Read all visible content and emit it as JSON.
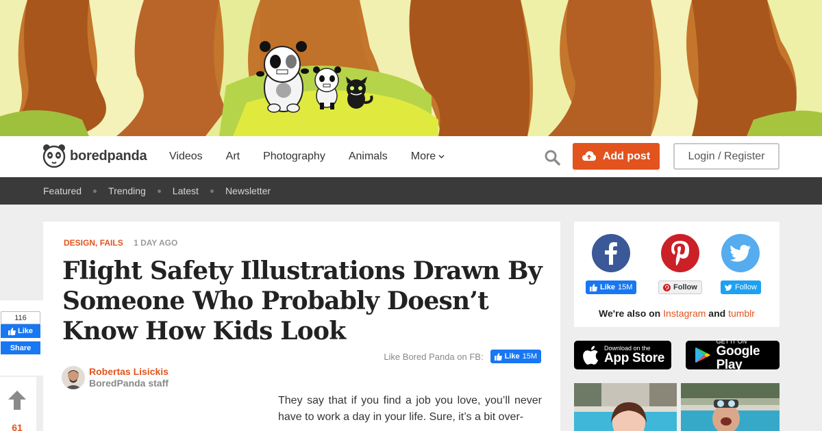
{
  "brand": {
    "name": "boredpanda"
  },
  "nav": {
    "items": [
      "Videos",
      "Art",
      "Photography",
      "Animals"
    ],
    "more_label": "More",
    "add_post_label": "Add post",
    "login_label": "Login / Register"
  },
  "subnav": {
    "items": [
      "Featured",
      "Trending",
      "Latest",
      "Newsletter"
    ]
  },
  "article": {
    "categories": [
      "DESIGN",
      "FAILS"
    ],
    "category_separator": ",",
    "time_ago": "1 DAY AGO",
    "title": "Flight Safety Illustrations Drawn By Someone Who Probably Doesn’t Know How Kids Look",
    "fb_prompt": "Like Bored Panda on FB:",
    "fb_like_label": "Like",
    "fb_like_count": "15M",
    "author_name": "Robertas Lisickis",
    "author_role": "BoredPanda staff",
    "body_text": "They say that if you find a job you love, you’ll never have to work a day in your life. Sure, it’s a bit over-"
  },
  "share": {
    "like_count": "116",
    "like_label": "Like",
    "share_label": "Share",
    "vote_count": "61"
  },
  "sidebar": {
    "facebook": {
      "label": "Like",
      "count": "15M"
    },
    "pinterest": {
      "label": "Follow"
    },
    "twitter": {
      "label": "Follow"
    },
    "also_prefix": "We're also on",
    "also_link1": "Instagram",
    "also_and": "and",
    "also_link2": "tumblr",
    "app_store": {
      "small": "Download on the",
      "big": "App Store"
    },
    "google_play": {
      "small": "GET IT ON",
      "big": "Google Play"
    }
  },
  "colors": {
    "accent": "#e2531e",
    "facebook": "#3b5998",
    "pinterest": "#cb2027",
    "twitter": "#55acee",
    "subnav_bg": "#3a3a3a"
  }
}
